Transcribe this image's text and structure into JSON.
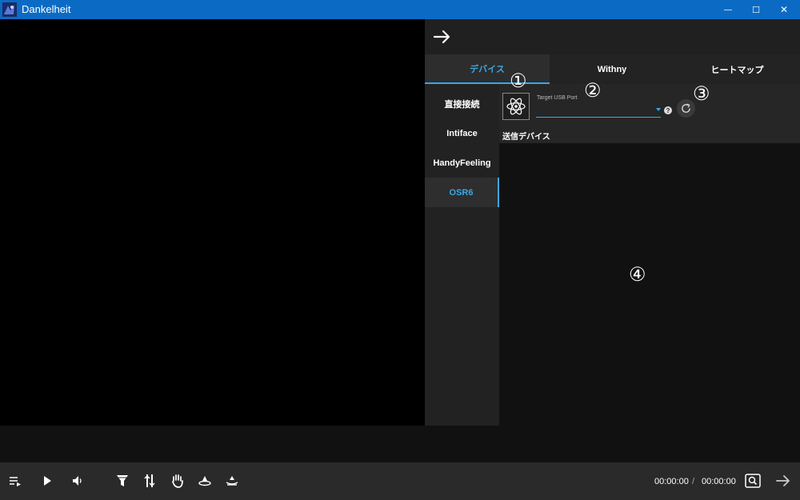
{
  "window": {
    "title": "Dankelheit",
    "minimize_glyph": "—",
    "maximize_glyph": "☐",
    "close_glyph": "✕"
  },
  "panel": {
    "top_tabs": [
      {
        "label": "デバイス",
        "active": true
      },
      {
        "label": "Withny",
        "active": false
      },
      {
        "label": "ヒートマップ",
        "active": false
      }
    ],
    "side_tabs": [
      {
        "label": "直接接続",
        "active": false
      },
      {
        "label": "Intiface",
        "active": false
      },
      {
        "label": "HandyFeeling",
        "active": false
      },
      {
        "label": "OSR6",
        "active": true
      }
    ],
    "device": {
      "port_label": "Target USB Port",
      "port_value": "",
      "help_glyph": "?",
      "send_device_label": "送信デバイス"
    },
    "annotations": [
      "①",
      "②",
      "③",
      "④"
    ]
  },
  "controls": {
    "current_time": "00:00:00",
    "separator": "/",
    "total_time": "00:00:00"
  },
  "colors": {
    "accent": "#3aa7e6",
    "titlebar": "#0b6bc4"
  },
  "icons": [
    "app-logo-icon",
    "arrow-right-icon",
    "atom-icon",
    "refresh-icon",
    "playlist-icon",
    "play-icon",
    "volume-icon",
    "funnel-icon",
    "stroke-icon",
    "hand-icon",
    "vibrate-icon",
    "rotate-icon",
    "zoom-icon",
    "arrow-right-icon"
  ]
}
